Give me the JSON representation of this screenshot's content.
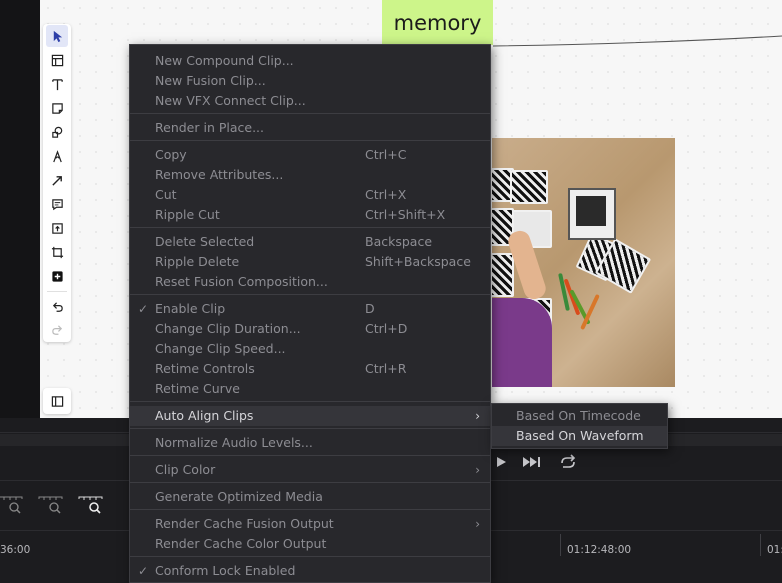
{
  "canvas": {
    "sticky_note_text": "memory",
    "toolbar": [
      {
        "name": "select-tool",
        "icon": "cursor-icon"
      },
      {
        "name": "frame-tool",
        "icon": "layout-icon"
      },
      {
        "name": "text-tool",
        "icon": "text-icon"
      },
      {
        "name": "sticky-note-tool",
        "icon": "sticky-note-icon"
      },
      {
        "name": "shape-tool",
        "icon": "shapes-icon"
      },
      {
        "name": "pen-tool",
        "icon": "pen-icon"
      },
      {
        "name": "arrow-tool",
        "icon": "arrow-icon"
      },
      {
        "name": "comment-tool",
        "icon": "comment-icon"
      },
      {
        "name": "upload-tool",
        "icon": "upload-icon"
      },
      {
        "name": "crop-tool",
        "icon": "crop-icon"
      },
      {
        "name": "add-tool",
        "icon": "plus-square-icon"
      },
      {
        "name": "undo-tool",
        "icon": "undo-icon"
      },
      {
        "name": "redo-tool",
        "icon": "redo-icon"
      }
    ],
    "panel_button_icon": "sidebar-panel-icon"
  },
  "timeline": {
    "ruler_left_label": "36:00",
    "ruler_mid_label": "01:12:48:00",
    "ruler_right_label": "01:"
  },
  "context_menu": {
    "new_compound_clip": "New Compound Clip...",
    "new_fusion_clip": "New Fusion Clip...",
    "new_vfx_connect_clip": "New VFX Connect Clip...",
    "render_in_place": "Render in Place...",
    "copy": {
      "label": "Copy",
      "shortcut": "Ctrl+C"
    },
    "remove_attributes": "Remove Attributes...",
    "cut": {
      "label": "Cut",
      "shortcut": "Ctrl+X"
    },
    "ripple_cut": {
      "label": "Ripple Cut",
      "shortcut": "Ctrl+Shift+X"
    },
    "delete_selected": {
      "label": "Delete Selected",
      "shortcut": "Backspace"
    },
    "ripple_delete": {
      "label": "Ripple Delete",
      "shortcut": "Shift+Backspace"
    },
    "reset_fusion": "Reset Fusion Composition...",
    "enable_clip": {
      "label": "Enable Clip",
      "shortcut": "D",
      "checked": true
    },
    "change_clip_duration": {
      "label": "Change Clip Duration...",
      "shortcut": "Ctrl+D"
    },
    "change_clip_speed": "Change Clip Speed...",
    "retime_controls": {
      "label": "Retime Controls",
      "shortcut": "Ctrl+R"
    },
    "retime_curve": "Retime Curve",
    "auto_align_clips": "Auto Align Clips",
    "normalize_audio": "Normalize Audio Levels...",
    "clip_color": "Clip Color",
    "generate_optimized_media": "Generate Optimized Media",
    "render_cache_fusion": "Render Cache Fusion Output",
    "render_cache_color": "Render Cache Color Output",
    "conform_lock": {
      "label": "Conform Lock Enabled",
      "checked": true
    },
    "check_glyph": "✓",
    "submenu_arrow": "›"
  },
  "auto_align_submenu": {
    "based_on_timecode": "Based On Timecode",
    "based_on_waveform": "Based On Waveform"
  }
}
